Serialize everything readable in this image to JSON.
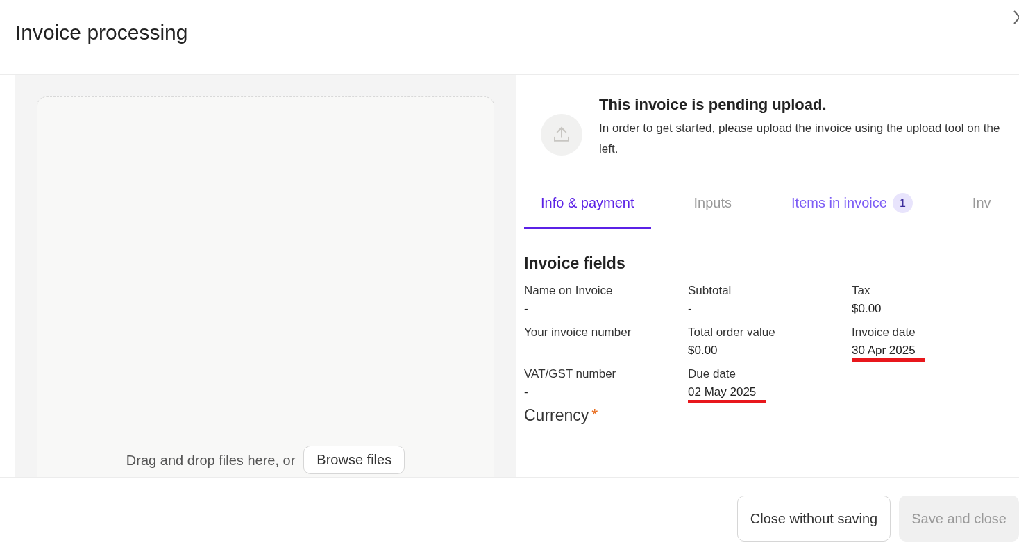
{
  "window": {
    "title": "Invoice processing"
  },
  "dropzone": {
    "text": "Drag and drop files here, or",
    "button": "Browse files"
  },
  "notice": {
    "title": "This invoice is pending upload.",
    "text": "In order to get started, please upload the invoice using the upload tool on the left."
  },
  "tabs": [
    {
      "label": "Info & payment",
      "selected": true,
      "disabled": false
    },
    {
      "label": "Inputs",
      "selected": false,
      "disabled": true
    },
    {
      "label": "Items in invoice",
      "selected": false,
      "disabled": false,
      "badge": "1"
    },
    {
      "label": "Inv",
      "selected": false,
      "disabled": true
    }
  ],
  "section": {
    "title": "Invoice fields"
  },
  "fields": [
    {
      "label": "Name on Invoice",
      "value": "-",
      "redacted": false
    },
    {
      "label": "Subtotal",
      "value": "-",
      "redacted": false
    },
    {
      "label": "Tax",
      "value": "$0.00",
      "redacted": false
    },
    {
      "label": "Your invoice number",
      "redacted": false
    },
    {
      "label": "Total order value",
      "value": "$0.00",
      "redacted": false
    },
    {
      "label": "Invoice date",
      "value": "30 Apr 2025",
      "redacted": true
    },
    {
      "label": "VAT/GST number",
      "value": "-",
      "redacted": false
    },
    {
      "label": "Due date",
      "value": "02 May 2025",
      "redacted": true
    }
  ],
  "currency": {
    "label": "Currency",
    "required_mark": "*"
  },
  "footer": {
    "buttons": [
      {
        "label": "Close without saving",
        "disabled": false
      },
      {
        "label": "Save and close",
        "disabled": true
      }
    ]
  }
}
